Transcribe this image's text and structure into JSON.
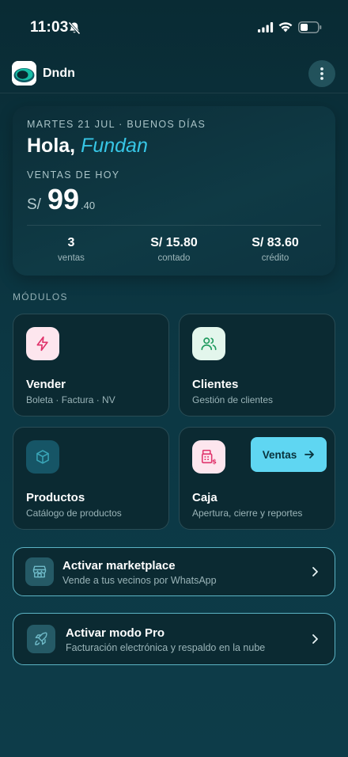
{
  "status_bar": {
    "time": "11:03"
  },
  "header": {
    "app_name": "Dndn"
  },
  "summary": {
    "date_line": "MARTES 21 JUL · BUENOS DÍAS",
    "greeting": "Hola,",
    "user_name": "Fundan",
    "sales_label": "VENTAS DE HOY",
    "currency": "S/",
    "amount_int": "99",
    "amount_dec": ".40",
    "stats": [
      {
        "value": "3",
        "label": "ventas"
      },
      {
        "value": "S/ 15.80",
        "label": "contado"
      },
      {
        "value": "S/ 83.60",
        "label": "crédito"
      }
    ]
  },
  "modules": {
    "title": "MÓDULOS",
    "items": [
      {
        "title": "Vender",
        "subtitle": "Boleta · Factura · NV",
        "icon": "bolt-icon"
      },
      {
        "title": "Clientes",
        "subtitle": "Gestión de clientes",
        "icon": "users-icon"
      },
      {
        "title": "Productos",
        "subtitle": "Catálogo de productos",
        "icon": "box-icon"
      },
      {
        "title": "Caja",
        "subtitle": "Apertura, cierre y reportes",
        "icon": "cash-register-icon"
      }
    ],
    "ventas_button": "Ventas"
  },
  "actions": [
    {
      "title": "Activar marketplace",
      "subtitle": "Vende a tus vecinos por WhatsApp",
      "icon": "store-icon"
    },
    {
      "title": "Activar modo Pro",
      "subtitle": "Facturación electrónica y respaldo en la nube",
      "icon": "rocket-icon"
    }
  ],
  "colors": {
    "accent": "#37c6e6",
    "button": "#5fd6f2",
    "background": "#0c3743",
    "vender_icon_bg": "#fde6ee",
    "clientes_icon_bg": "#e3f6ec",
    "caja_icon_bg": "#fde6ee"
  }
}
